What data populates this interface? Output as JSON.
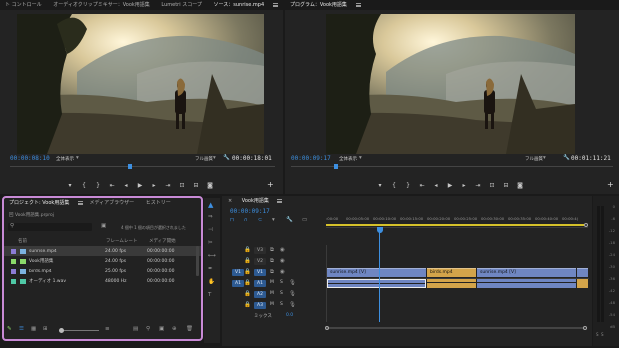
{
  "app": {
    "top_tabs": [
      {
        "label": "ト コントロール",
        "active": false
      },
      {
        "label": "オーディオクリップミキサー：Vook用語集",
        "active": false
      },
      {
        "label": "Lumetri スコープ",
        "active": false
      },
      {
        "label": "ソース：sunrise.mp4",
        "active": true
      }
    ],
    "program_tab": "プログラム：Vook用語集"
  },
  "source_monitor": {
    "timecode_in": "00:00:08:10",
    "fit": "全体表示",
    "quality": "フル画質",
    "duration": "00:00:18:01"
  },
  "program_monitor": {
    "timecode_in": "00:00:09:17",
    "fit": "全体表示",
    "quality": "フル画質",
    "duration": "00:01:11:21"
  },
  "transport": {
    "buttons": [
      "marker",
      "in",
      "out",
      "go-in",
      "step-back",
      "play",
      "step-fwd",
      "go-out",
      "insert",
      "overwrite",
      "export"
    ]
  },
  "project": {
    "tabs": [
      {
        "label": "プロジェクト: Vook用語集",
        "active": true
      },
      {
        "label": "メディアブラウザー",
        "active": false
      },
      {
        "label": "ヒストリー",
        "active": false
      }
    ],
    "file": "Vook用語集.prproj",
    "file_prefix": "回",
    "selection_info": "4 個中 1 個の項目が選択されました",
    "columns": [
      "名前",
      "フレームレート",
      "メディア開始"
    ],
    "items": [
      {
        "name": "sunrise.mp4",
        "fps": "24.00 fps",
        "start": "00:00:00:00",
        "color": "#8c7cd6",
        "selected": true
      },
      {
        "name": "Vook用語集",
        "fps": "24.00 fps",
        "start": "00:00:00:00",
        "color": "#8bd96a",
        "selected": false
      },
      {
        "name": "birds.mp4",
        "fps": "25.00 fps",
        "start": "00:00:00:00",
        "color": "#8c7cd6",
        "selected": false
      },
      {
        "name": "オーディオ 1.wav",
        "fps": "48000 Hz",
        "start": "00:00:00:00",
        "color": "#4fc9a6",
        "selected": false
      }
    ]
  },
  "timeline": {
    "tab": "Vook用語集",
    "timecode": "00:00:09:17",
    "ruler": [
      ":00:00",
      "00:00:05:00",
      "00:00:10:00",
      "00:00:15:00",
      "00:00:20:00",
      "00:00:25:00",
      "00:00:30:00",
      "00:00:35:00",
      "00:00:40:00",
      "00:00:4("
    ],
    "video_tracks": [
      "V3",
      "V2",
      "V1"
    ],
    "audio_tracks": [
      "A1",
      "A2",
      "A3"
    ],
    "source_patch_video": "V1",
    "source_patch_audio": "A1",
    "mix_label": "ミックス",
    "mix_value": "0.0",
    "clips": {
      "v1": [
        {
          "label": "sunrise.mp4 [V]",
          "color": "#6f86c2"
        },
        {
          "label": "birds.mp4",
          "color": "#d3a44a"
        },
        {
          "label": "sunrise.mp4 [V]",
          "color": "#6f86c2"
        },
        {
          "label": "",
          "color": "#6f86c2"
        }
      ]
    },
    "mute_label": "M",
    "solo_label": "S"
  },
  "meter": {
    "scale": [
      "0",
      "-6",
      "-12",
      "-18",
      "-24",
      "-30",
      "-36",
      "-42",
      "-48",
      "-54",
      "dB"
    ],
    "s_labels": [
      "S",
      "S"
    ]
  },
  "colors": {
    "accent": "#3d8fe0",
    "highlight": "#c88ad6",
    "playhead": "#3d8fe0"
  }
}
